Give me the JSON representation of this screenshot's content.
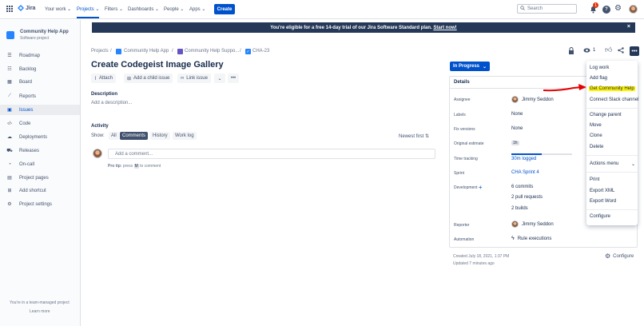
{
  "topnav": {
    "brand": "Jira",
    "items": [
      "Your work",
      "Projects",
      "Filters",
      "Dashboards",
      "People",
      "Apps"
    ],
    "create": "Create",
    "search_placeholder": "Search",
    "notif_count": "1"
  },
  "sidebar": {
    "project_name": "Community Help App",
    "project_type": "Software project",
    "items": [
      "Roadmap",
      "Backlog",
      "Board",
      "Reports",
      "Issues",
      "Code",
      "Deployments",
      "Releases",
      "On-call",
      "Project pages",
      "Add shortcut",
      "Project settings"
    ],
    "footer_text": "You're in a team-managed project",
    "footer_link": "Learn more"
  },
  "banner": {
    "text": "You're eligible for a free 14-day trial of our Jira Software Standard plan.",
    "link": "Start now!",
    "close": "×"
  },
  "breadcrumb": [
    "Projects",
    "Community Help App",
    "Community Help Suppo...",
    "CHA-23"
  ],
  "issue": {
    "title": "Create Codegeist Image Gallery",
    "toolbar": [
      "Attach",
      "Add a child issue",
      "Link issue"
    ],
    "description_label": "Description",
    "description_placeholder": "Add a description..."
  },
  "activity": {
    "label": "Activity",
    "show": "Show:",
    "tabs": [
      "All",
      "Comments",
      "History",
      "Work log"
    ],
    "sort": "Newest first",
    "comment_placeholder": "Add a comment...",
    "protip_prefix": "Pro tip:",
    "protip_mid": "press",
    "protip_key": "M",
    "protip_suffix": "to comment"
  },
  "details": {
    "status": "In Progress",
    "watch_count": "1",
    "heading": "Details",
    "assignee_label": "Assignee",
    "assignee": "Jimmy Seddon",
    "labels_label": "Labels",
    "labels": "None",
    "fix_label": "Fix versions",
    "fix": "None",
    "estimate_label": "Original estimate",
    "estimate": "1h",
    "tracking_label": "Time tracking",
    "tracking": "30m logged",
    "tracking_progress": 0.5,
    "sprint_label": "Sprint",
    "sprint": "CHA Sprint 4",
    "dev_label": "Development",
    "commits": "6 commits",
    "pulls": "2 pull requests",
    "builds": "2 builds",
    "reporter_label": "Reporter",
    "reporter": "Jimmy Seddon",
    "automation_label": "Automation",
    "automation": "Rule executions",
    "created": "Created July 18, 2021, 1:37 PM",
    "updated": "Updated 7 minutes ago",
    "configure": "Configure"
  },
  "menu": {
    "items": [
      "Log work",
      "Add flag",
      "Get Community Help",
      "Connect Slack channel",
      "Change parent",
      "Move",
      "Clone",
      "Delete",
      "Actions menu",
      "Print",
      "Export XML",
      "Export Word",
      "Configure"
    ]
  },
  "colors": {
    "brand": "#0052cc",
    "banner": "#253858",
    "highlight": "#fff200",
    "annotation_arrow": "#e60000"
  }
}
